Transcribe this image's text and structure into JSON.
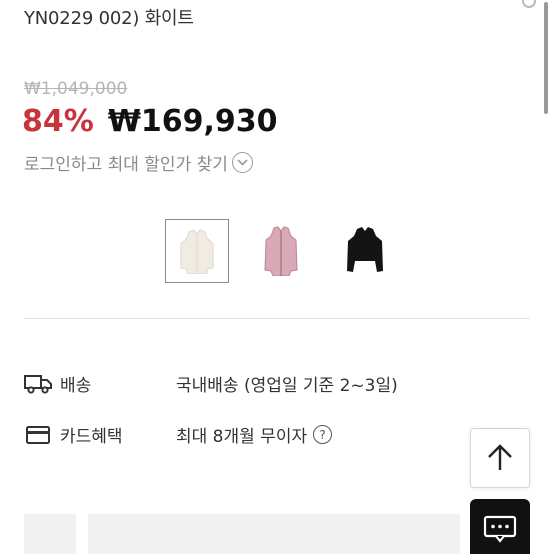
{
  "product": {
    "title_line": "YN0229 002) 화이트",
    "original_price": "₩1,049,000",
    "discount": "84%",
    "sale_price": "₩169,930",
    "login_discount_text": "로그인하고 최대 할인가 찾기"
  },
  "thumbnails": [
    {
      "name": "white",
      "color": "#f1ece3",
      "selected": true
    },
    {
      "name": "pink",
      "color": "#d9a9b6",
      "selected": false
    },
    {
      "name": "black",
      "color": "#141414",
      "selected": false
    }
  ],
  "info": {
    "shipping": {
      "icon": "truck-icon",
      "label": "배송",
      "value": "국내배송 (영업일 기준 2~3일)"
    },
    "card": {
      "icon": "credit-card-icon",
      "label": "카드혜택",
      "value": "최대 8개월 무이자",
      "help": "?"
    }
  },
  "floating": {
    "scroll_top_icon": "arrow-up-icon",
    "chat_icon": "chat-bubble-icon"
  },
  "colors": {
    "discount": "#c8343b",
    "muted": "#8a8a8a",
    "chat_button": "#111111"
  }
}
